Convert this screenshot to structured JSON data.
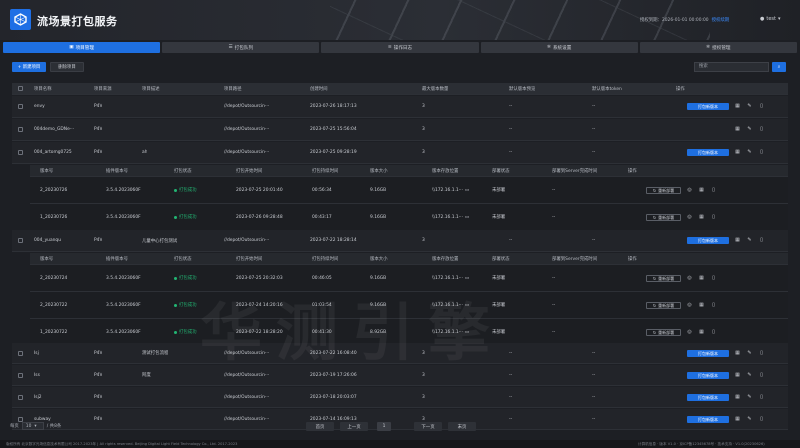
{
  "app": {
    "title": "流场景打包服务",
    "expiry_label": "授权到期：2026-01-01 00:00:00",
    "expiry_link": "授权续期",
    "user": "test"
  },
  "tabs": [
    {
      "label": "项目管理",
      "icon": "project-icon",
      "active": true
    },
    {
      "label": "打包队列",
      "icon": "queue-icon",
      "active": false
    },
    {
      "label": "操作日志",
      "icon": "log-icon",
      "active": false
    },
    {
      "label": "系统设置",
      "icon": "gear-icon",
      "active": false
    },
    {
      "label": "授权管理",
      "icon": "gear-icon",
      "active": false
    }
  ],
  "toolbar": {
    "new_project": "+ 新建项目",
    "delete_project": "删除项目",
    "search_placeholder": "搜索"
  },
  "table": {
    "headers": [
      "项目名称",
      "项目来源",
      "项目描述",
      "项目路径",
      "创建时间",
      "最大版本数量",
      "默认版本预览",
      "默认版本token",
      "操作"
    ],
    "pack_button": "打包新版本",
    "rows": [
      {
        "name": "envy",
        "source": "P4V",
        "desc": "",
        "path": "//depot/Outsourcin···",
        "time": "2023-07-26 18:17:13",
        "max": "3",
        "preview": "--",
        "token": "--"
      },
      {
        "name": "004demo_GDNe···",
        "source": "P4V",
        "desc": "",
        "path": "//depot/Outsourcin···",
        "time": "2023-07-25 15:56:04",
        "max": "3",
        "preview": "--",
        "token": "--"
      },
      {
        "name": "004_artomg0725",
        "source": "P4V",
        "desc": "ah",
        "path": "//depot/Outsourcin···",
        "time": "2023-07-25 09:28:19",
        "max": "3",
        "preview": "--",
        "token": "--"
      },
      {
        "name": "004_yuanqu",
        "source": "P4V",
        "desc": "儿童中心打包测试",
        "path": "//depot/Outsourcin···",
        "time": "2023-07-22 18:28:14",
        "max": "3",
        "preview": "--",
        "token": "--"
      },
      {
        "name": "Isj",
        "source": "P4V",
        "desc": "测试打包流程",
        "path": "//depot/Outsourcin···",
        "time": "2023-07-22 16:08:40",
        "max": "3",
        "preview": "--",
        "token": "--"
      },
      {
        "name": "Iss",
        "source": "P4V",
        "desc": "阿度",
        "path": "//depot/Outsourcin···",
        "time": "2023-07-19 17:26:06",
        "max": "3",
        "preview": "--",
        "token": "--"
      },
      {
        "name": "Isj2",
        "source": "P4V",
        "desc": "",
        "path": "//depot/Outsourcin···",
        "time": "2023-07-18 20:03:07",
        "max": "3",
        "preview": "--",
        "token": "--"
      },
      {
        "name": "subway",
        "source": "P4V",
        "desc": "",
        "path": "//depot/Outsourcin···",
        "time": "2023-07-14 16:09:13",
        "max": "3",
        "preview": "--",
        "token": "--"
      }
    ]
  },
  "subtable": {
    "headers": [
      "版本号",
      "插件版本号",
      "打包状态",
      "打包开始时间",
      "打包持续时间",
      "版本大小",
      "版本存放位置",
      "部署状态",
      "部署到Server完成时间",
      "操作"
    ],
    "rebuild_label": "重新部署",
    "groups": [
      [
        {
          "ver": "2_20230726",
          "plugin": "3.5.4.2023060F",
          "status": "打包成功",
          "start": "2023-07-25 20:01:40",
          "dur": "00:56:34",
          "size": "9.16GB",
          "loc": "\\\\172.16.1.1···",
          "deploy": "未部署",
          "done": "--"
        },
        {
          "ver": "1_20230726",
          "plugin": "3.5.4.2023060F",
          "status": "打包成功",
          "start": "2023-07-26 09:28:48",
          "dur": "00:43:17",
          "size": "9.16GB",
          "loc": "\\\\172.16.1.1···",
          "deploy": "未部署",
          "done": "--"
        }
      ],
      [
        {
          "ver": "2_20230724",
          "plugin": "3.5.4.2023060F",
          "status": "打包成功",
          "start": "2023-07-25 20:32:03",
          "dur": "00:46:05",
          "size": "9.16GB",
          "loc": "\\\\172.16.1.1···",
          "deploy": "未部署",
          "done": "--"
        },
        {
          "ver": "2_20230722",
          "plugin": "3.5.4.2023060F",
          "status": "打包成功",
          "start": "2023-07-24 14:20:16",
          "dur": "01:03:54",
          "size": "9.16GB",
          "loc": "\\\\172.16.1.1···",
          "deploy": "未部署",
          "done": "--"
        },
        {
          "ver": "1_20230722",
          "plugin": "3.5.4.2023060F",
          "status": "打包成功",
          "start": "2023-07-22 18:28:20",
          "dur": "00:41:30",
          "size": "8.92GB",
          "loc": "\\\\172.16.1.1···",
          "deploy": "未部署",
          "done": "--"
        }
      ]
    ]
  },
  "pager": {
    "total_prefix": "每页",
    "page_size": "10",
    "total_suffix": "/ 共8条",
    "first": "首页",
    "prev": "上一页",
    "page": "1",
    "next": "下一页",
    "last": "末页"
  },
  "footer": {
    "left": "版权所有 北京数字光场信息技术有限公司 2017-2023年 | All rights reserved. Beijing Digital Light Field Technology Co., Ltd. 2017-2023",
    "right": "计算机信息 · 版本 V1.0 · 京ICP备12345678号 · 技术支持 · V1.0(20230626)"
  },
  "watermark": "华测引擎",
  "colors": {
    "accent": "#1e6fe0",
    "success": "#22b573",
    "bg": "#1d1f24"
  }
}
